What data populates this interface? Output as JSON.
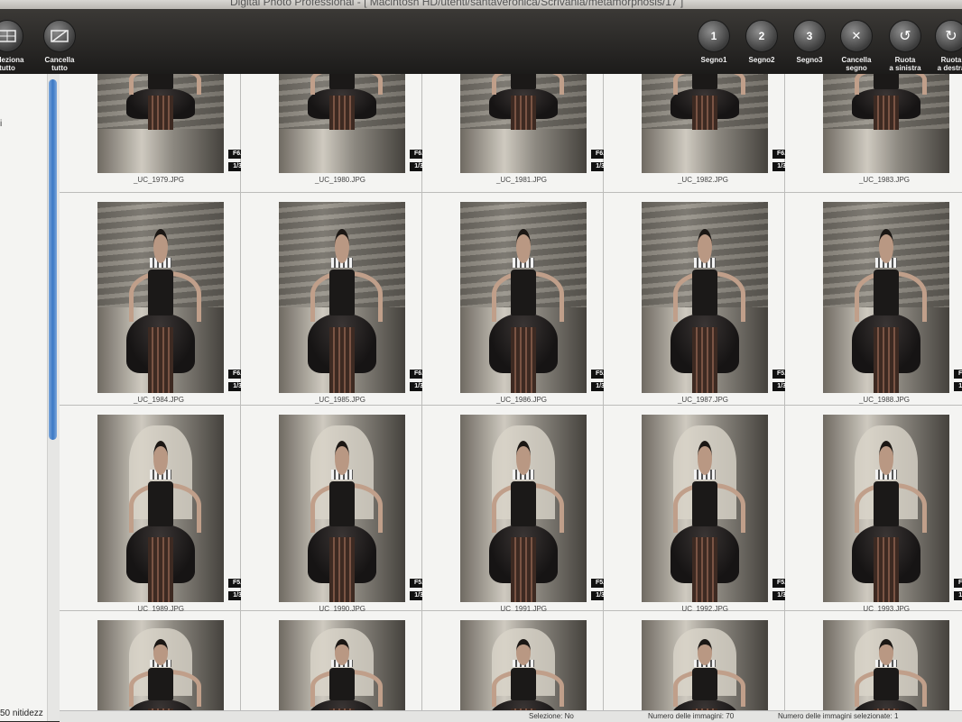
{
  "window": {
    "title": "Digital Photo Professional - [ Macintosh HD/utenti/santaveronica/Scrivania/metamorphosis/17 ]"
  },
  "toolbar": {
    "left": [
      {
        "label": "Seleziona\ntutto",
        "icon": "select-all-icon"
      },
      {
        "label": "Cancella\ntutto",
        "icon": "clear-all-icon"
      }
    ],
    "right": [
      {
        "label": "Segno1",
        "icon": "mark1-icon",
        "glyph": "1"
      },
      {
        "label": "Segno2",
        "icon": "mark2-icon",
        "glyph": "2"
      },
      {
        "label": "Segno3",
        "icon": "mark3-icon",
        "glyph": "3"
      },
      {
        "label": "Cancella\nsegno",
        "icon": "clear-mark-icon",
        "glyph": "✕"
      },
      {
        "label": "Ruota\na sinistra",
        "icon": "rotate-left-icon",
        "glyph": "↺"
      },
      {
        "label": "Ruota\na destra",
        "icon": "rotate-right-icon",
        "glyph": "↻"
      }
    ]
  },
  "left_panel": {
    "side_text": "i",
    "sharpness_label": "50 nitidezz"
  },
  "thumbnails": [
    {
      "file": "_UC_1979.JPG",
      "aperture": "F6.3",
      "shutter": "1/30"
    },
    {
      "file": "_UC_1980.JPG",
      "aperture": "F6.3",
      "shutter": "1/30"
    },
    {
      "file": "_UC_1981.JPG",
      "aperture": "F6.3",
      "shutter": "1/30"
    },
    {
      "file": "_UC_1982.JPG",
      "aperture": "F6.3",
      "shutter": "1/30"
    },
    {
      "file": "_UC_1983.JPG",
      "aperture": "",
      "shutter": ""
    },
    {
      "file": "_UC_1984.JPG",
      "aperture": "F6.3",
      "shutter": "1/30"
    },
    {
      "file": "_UC_1985.JPG",
      "aperture": "F6.3",
      "shutter": "1/30"
    },
    {
      "file": "_UC_1986.JPG",
      "aperture": "F5.0",
      "shutter": "1/30"
    },
    {
      "file": "_UC_1987.JPG",
      "aperture": "F5.0",
      "shutter": "1/30"
    },
    {
      "file": "_UC_1988.JPG",
      "aperture": "F5.0",
      "shutter": "1/30"
    },
    {
      "file": "_UC_1989.JPG",
      "aperture": "F5.0",
      "shutter": "1/30"
    },
    {
      "file": "_UC_1990.JPG",
      "aperture": "F5.0",
      "shutter": "1/30"
    },
    {
      "file": "_UC_1991.JPG",
      "aperture": "F5.0",
      "shutter": "1/30"
    },
    {
      "file": "_UC_1992.JPG",
      "aperture": "F5.0",
      "shutter": "1/30"
    },
    {
      "file": "_UC_1993.JPG",
      "aperture": "F5.0",
      "shutter": "1/30"
    },
    {
      "file": "",
      "aperture": "",
      "shutter": ""
    },
    {
      "file": "",
      "aperture": "",
      "shutter": ""
    },
    {
      "file": "",
      "aperture": "",
      "shutter": ""
    },
    {
      "file": "",
      "aperture": "",
      "shutter": ""
    },
    {
      "file": "",
      "aperture": "",
      "shutter": ""
    }
  ],
  "status": {
    "selection_label": "Selezione: No",
    "total": "Numero delle immagini: 70",
    "selected": "Numero delle immagini selezionate: 1"
  }
}
